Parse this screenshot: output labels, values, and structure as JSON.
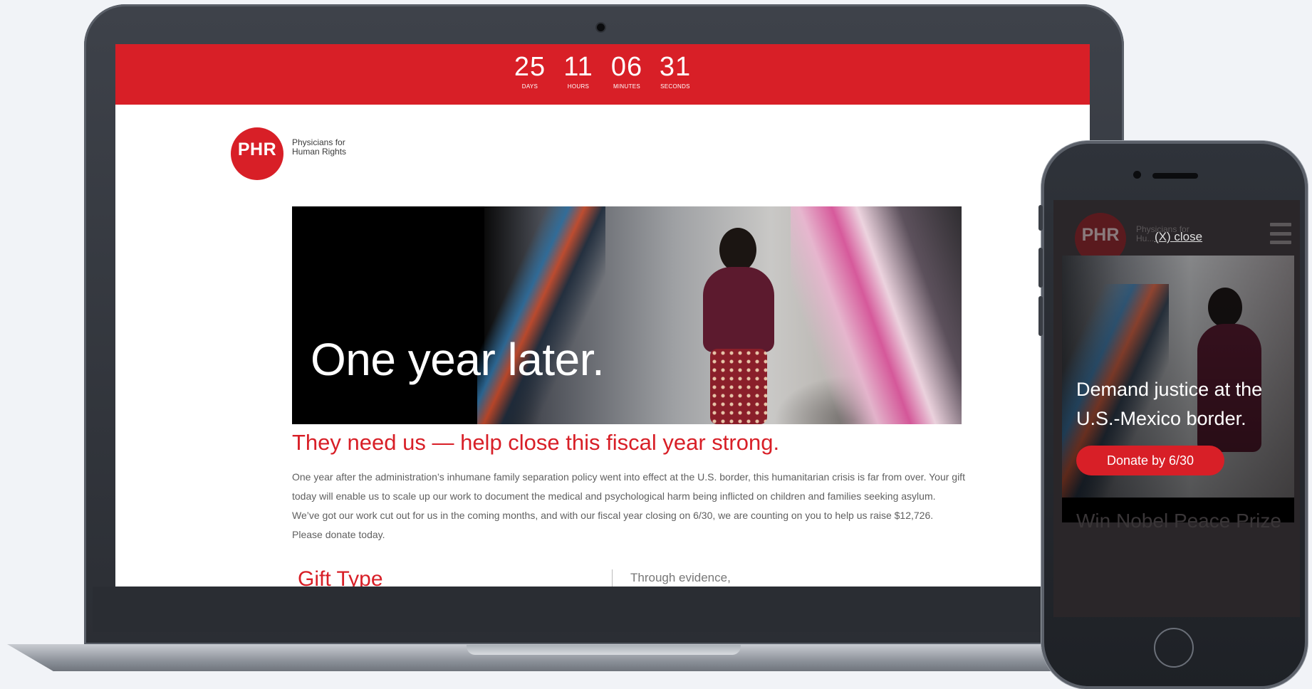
{
  "countdown": [
    {
      "value": "25",
      "label": "DAYS"
    },
    {
      "value": "11",
      "label": "HOURS"
    },
    {
      "value": "06",
      "label": "MINUTES"
    },
    {
      "value": "31",
      "label": "SECONDS"
    }
  ],
  "logo": {
    "mark": "PHR",
    "text": "Physicians for Human Rights"
  },
  "hero": {
    "title": "One year later."
  },
  "subheading": "They need us — help close this fiscal year strong.",
  "body": "One year after the administration’s inhumane family separation policy went into effect at the U.S. border, this humanitarian crisis is far from over. Your gift today will enable us to scale up our work to document the medical and psychological harm being inflicted on children and families seeking asylum. We’ve got our work cut out for us in the coming months, and with our fiscal year closing on 6/30, we are counting on you to help us raise $12,726. Please donate today.",
  "gift_type": "Gift Type",
  "evidence": "Through evidence,",
  "phone": {
    "logo_mark": "PHR",
    "logo_text": "Physicians for Hu...",
    "close": "(X) close",
    "modal_text": "Demand justice at the U.S.-Mexico border.",
    "donate_button": "Donate by 6/30",
    "behind_text": "Win Nobel Peace Prize"
  },
  "colors": {
    "brand_red": "#d81f27"
  }
}
